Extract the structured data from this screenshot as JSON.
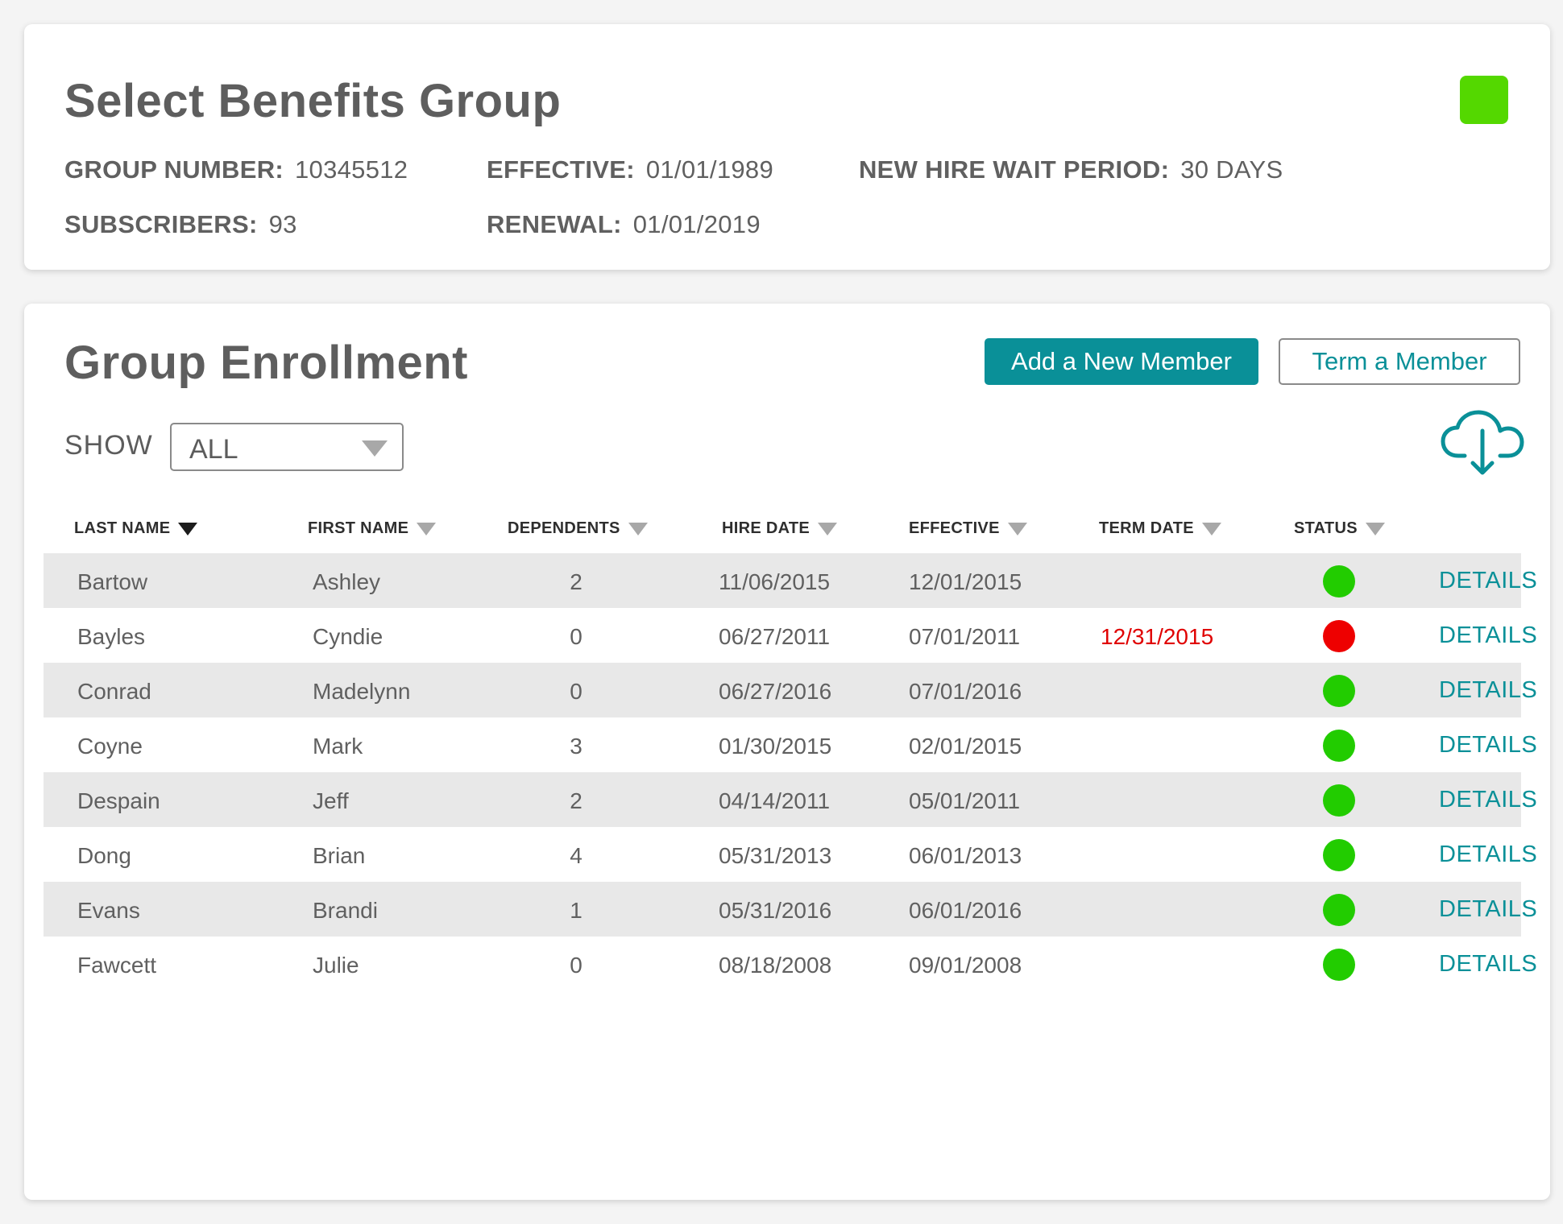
{
  "group": {
    "title": "Select Benefits Group",
    "status_color": "#54d800",
    "group_number_label": "GROUP NUMBER:",
    "group_number": "10345512",
    "effective_label": "EFFECTIVE:",
    "effective": "01/01/1989",
    "wait_label": "NEW HIRE WAIT PERIOD:",
    "wait": "30 DAYS",
    "subscribers_label": "SUBSCRIBERS:",
    "subscribers": "93",
    "renewal_label": "RENEWAL:",
    "renewal": "01/01/2019"
  },
  "enrollment": {
    "title": "Group Enrollment",
    "add_button": "Add a New Member",
    "term_button": "Term a Member",
    "show_label": "SHOW",
    "show_value": "ALL",
    "download_icon": "cloud-download-icon",
    "accent_color": "#0a9098",
    "columns": [
      "LAST NAME",
      "FIRST NAME",
      "DEPENDENTS",
      "HIRE DATE",
      "EFFECTIVE",
      "TERM DATE",
      "STATUS"
    ],
    "sorted_column": "LAST NAME",
    "details_label": "DETAILS",
    "status_colors": {
      "active": "#22cc00",
      "termed": "#ee0000"
    },
    "rows": [
      {
        "last": "Bartow",
        "first": "Ashley",
        "dependents": "2",
        "hire": "11/06/2015",
        "effective": "12/01/2015",
        "term": "",
        "status": "active"
      },
      {
        "last": "Bayles",
        "first": "Cyndie",
        "dependents": "0",
        "hire": "06/27/2011",
        "effective": "07/01/2011",
        "term": "12/31/2015",
        "status": "termed"
      },
      {
        "last": "Conrad",
        "first": "Madelynn",
        "dependents": "0",
        "hire": "06/27/2016",
        "effective": "07/01/2016",
        "term": "",
        "status": "active"
      },
      {
        "last": "Coyne",
        "first": "Mark",
        "dependents": "3",
        "hire": "01/30/2015",
        "effective": "02/01/2015",
        "term": "",
        "status": "active"
      },
      {
        "last": "Despain",
        "first": "Jeff",
        "dependents": "2",
        "hire": "04/14/2011",
        "effective": "05/01/2011",
        "term": "",
        "status": "active"
      },
      {
        "last": "Dong",
        "first": "Brian",
        "dependents": "4",
        "hire": "05/31/2013",
        "effective": "06/01/2013",
        "term": "",
        "status": "active"
      },
      {
        "last": "Evans",
        "first": "Brandi",
        "dependents": "1",
        "hire": "05/31/2016",
        "effective": "06/01/2016",
        "term": "",
        "status": "active"
      },
      {
        "last": "Fawcett",
        "first": "Julie",
        "dependents": "0",
        "hire": "08/18/2008",
        "effective": "09/01/2008",
        "term": "",
        "status": "active"
      }
    ]
  }
}
